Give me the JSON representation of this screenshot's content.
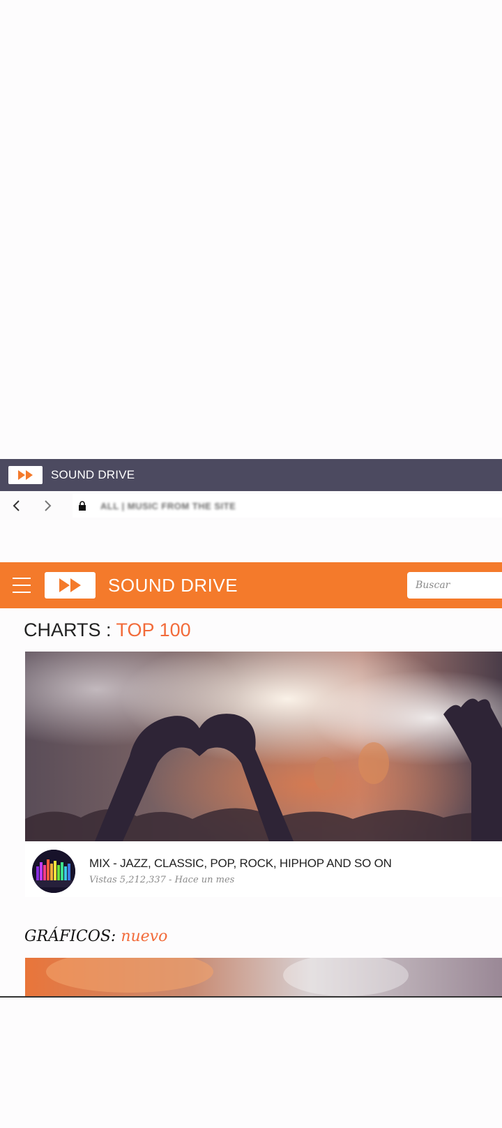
{
  "browser": {
    "tab_title": "SOUND DRIVE",
    "url": "ALL | MUSIC FROM THE SITE"
  },
  "header": {
    "site_name": "SOUND DRIVE",
    "search_placeholder": "Buscar",
    "brand_color": "#f47a2b"
  },
  "charts": {
    "prefix": "CHARTS : ",
    "accent": "TOP 100"
  },
  "video": {
    "title": "MIX - JAZZ, CLASSIC, POP, ROCK, HIPHOP AND SO ON",
    "meta": "Vistas 5,212,337 - Hace un mes"
  },
  "graficos": {
    "prefix": "GRÁFICOS: ",
    "accent": "nuevo"
  },
  "icons": {
    "tab_favicon": "fast-forward-icon",
    "back": "chevron-left-icon",
    "forward": "chevron-right-icon",
    "lock": "lock-icon",
    "menu": "hamburger-icon",
    "logo": "fast-forward-icon"
  }
}
